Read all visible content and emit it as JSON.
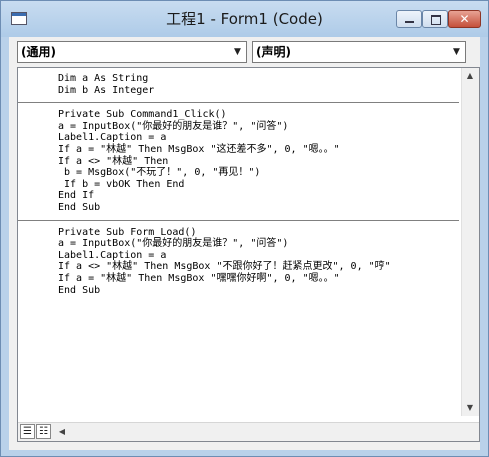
{
  "window": {
    "title": "工程1 - Form1 (Code)",
    "controls": {
      "minimize_icon": "minimize-icon",
      "maximize_icon": "maximize-icon",
      "close_icon": "close-icon",
      "close_glyph": "✕"
    }
  },
  "object_combo": {
    "value": "(通用)"
  },
  "procedure_combo": {
    "value": "(声明)"
  },
  "code": {
    "declarations": [
      "Dim a As String",
      "Dim b As Integer"
    ],
    "command1_click": [
      "Private Sub Command1_Click()",
      "a = InputBox(\"你最好的朋友是谁？\", \"问答\")",
      "Label1.Caption = a",
      "If a = \"林越\" Then MsgBox \"这还差不多\", 0, \"嗯。。\"",
      "If a <> \"林越\" Then",
      " b = MsgBox(\"不玩了！\", 0, \"再见！\")",
      " If b = vbOK Then End",
      "End If",
      "End Sub"
    ],
    "form_load": [
      "Private Sub Form_Load()",
      "a = InputBox(\"你最好的朋友是谁？\", \"问答\")",
      "Label1.Caption = a",
      "If a <> \"林越\" Then MsgBox \"不跟你好了！赶紧点更改\", 0, \"哼\"",
      "If a = \"林越\" Then MsgBox \"嘿嘿你好啊\", 0, \"嗯。。\"",
      "End Sub"
    ]
  }
}
